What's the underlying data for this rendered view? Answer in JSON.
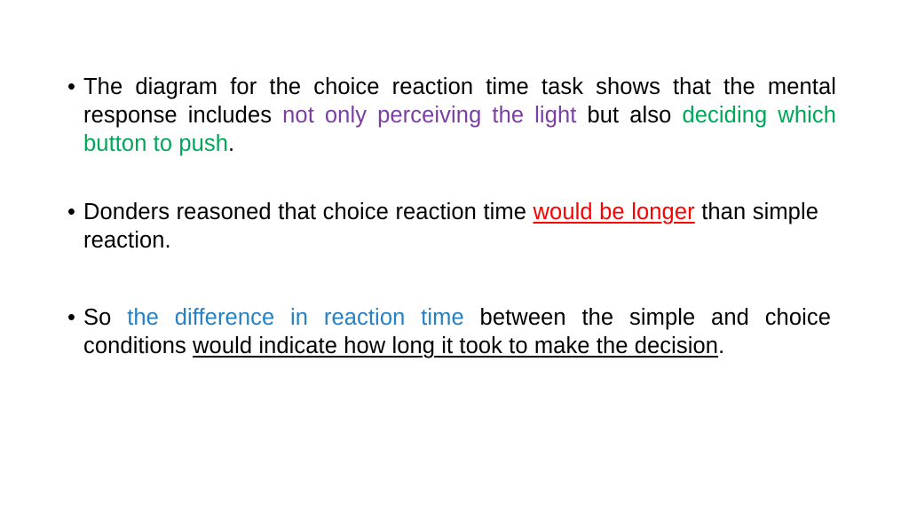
{
  "slide": {
    "background_color": "#ffffff",
    "text_color": "#000000",
    "bullet_glyph": "•",
    "accent_colors": {
      "purple": "#7B3FA3",
      "green": "#00A758",
      "blue": "#2681C4",
      "red": "#FF0000"
    },
    "bullets": [
      {
        "id": "bullet-1",
        "segments": [
          {
            "text": "The  diagram   for  the  choice  reaction   time task shows   that   the  mental response  includes ",
            "style": "plain"
          },
          {
            "text": "not  only  perceiving  the  light",
            "style": "purple"
          },
          {
            "text": " but also ",
            "style": "plain"
          },
          {
            "text": "deciding which button to push",
            "style": "green"
          },
          {
            "text": ".",
            "style": "plain"
          }
        ],
        "plain_text": "The diagram for the choice reaction time task shows that the mental response includes not only perceiving the light but also deciding which button to push."
      },
      {
        "id": "bullet-2",
        "segments": [
          {
            "text": "Donders reasoned   that   choice  reaction   time  ",
            "style": "plain"
          },
          {
            "text": "would  be longer",
            "style": "red-underline"
          },
          {
            "text": " than  simple reaction.",
            "style": "plain"
          }
        ],
        "plain_text": "Donders reasoned that choice reaction time would be longer than simple reaction."
      },
      {
        "id": "bullet-3",
        "segments": [
          {
            "text": "So ",
            "style": "plain"
          },
          {
            "text": "the difference in reaction  time",
            "style": "blue"
          },
          {
            "text": " between  the simple and  choice  conditions ",
            "style": "plain"
          },
          {
            "text": "would  indicate  how  long it took  to make the decision",
            "style": "black-underline"
          },
          {
            "text": ".",
            "style": "plain"
          }
        ],
        "plain_text": "So the difference in reaction time between the simple and choice conditions would indicate how long it took to make the decision."
      }
    ]
  }
}
